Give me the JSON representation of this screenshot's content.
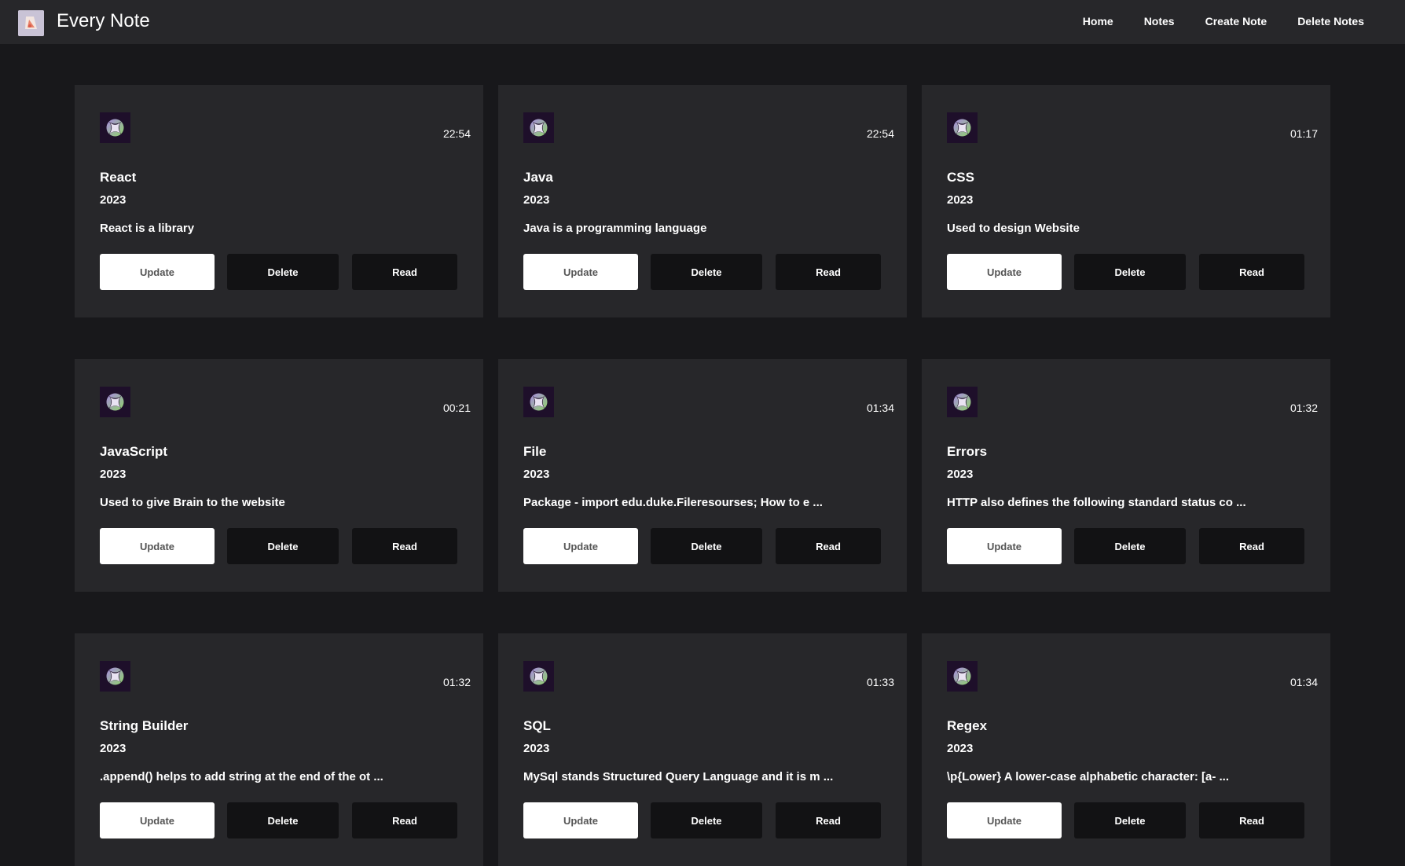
{
  "app": {
    "title": "Every Note"
  },
  "nav": {
    "items": [
      "Home",
      "Notes",
      "Create Note",
      "Delete Notes"
    ]
  },
  "colors": {
    "background": "#18181b",
    "navbar": "#27272a",
    "card": "#27272a",
    "button_light": "#ffffff",
    "button_dark": "#121214"
  },
  "card_icon": "xbox-logo-icon",
  "buttons": {
    "update": "Update",
    "delete": "Delete",
    "read": "Read"
  },
  "notes": [
    {
      "title": "React",
      "year": "2023",
      "time": "22:54",
      "description": "React is a library"
    },
    {
      "title": "Java",
      "year": "2023",
      "time": "22:54",
      "description": "Java is a programming language"
    },
    {
      "title": "CSS",
      "year": "2023",
      "time": "01:17",
      "description": "Used to design Website"
    },
    {
      "title": "JavaScript",
      "year": "2023",
      "time": "00:21",
      "description": "Used to give Brain to the website"
    },
    {
      "title": "File",
      "year": "2023",
      "time": "01:34",
      "description": "Package - import edu.duke.Fileresourses; How to e ..."
    },
    {
      "title": "Errors",
      "year": "2023",
      "time": "01:32",
      "description": "HTTP also defines the following standard status co ..."
    },
    {
      "title": "String Builder",
      "year": "2023",
      "time": "01:32",
      "description": ".append() helps to add string at the end of the ot ..."
    },
    {
      "title": "SQL",
      "year": "2023",
      "time": "01:33",
      "description": "MySql stands Structured Query Language and it is m ..."
    },
    {
      "title": "Regex",
      "year": "2023",
      "time": "01:34",
      "description": "\\p{Lower} A lower-case alphabetic character: [a- ..."
    }
  ]
}
